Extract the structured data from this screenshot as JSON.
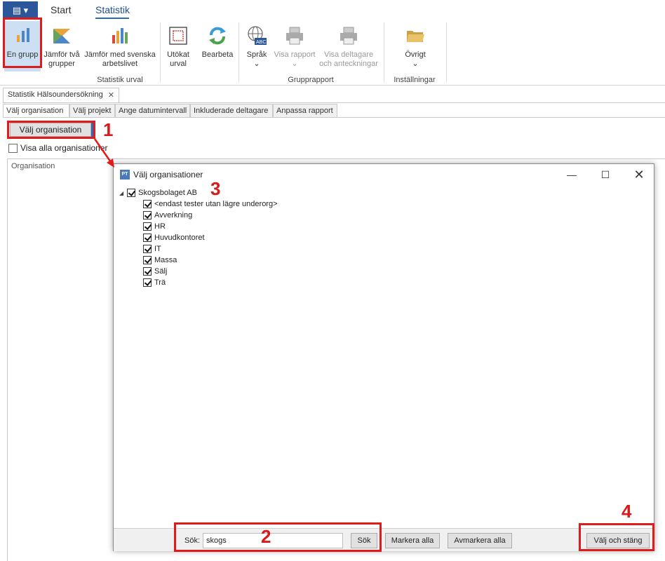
{
  "ribbon": {
    "tabs": [
      "Start",
      "Statistik"
    ],
    "active_tab": "Statistik",
    "buttons": {
      "en_grupp": "En grupp",
      "jamfor_tva": [
        "Jämför två",
        "grupper"
      ],
      "jamfor_svenska": [
        "Jämför med svenska",
        "arbetslivet"
      ],
      "utokat": [
        "Utökat",
        "urval"
      ],
      "bearbeta": "Bearbeta",
      "sprak": "Språk",
      "visa_rapport": "Visa rapport",
      "visa_deltagare": [
        "Visa deltagare",
        "och anteckningar"
      ],
      "ovrigt": "Övrigt"
    },
    "groups": {
      "statistik_urval": "Statistik urval",
      "grupprapport": "Grupprapport",
      "installningar": "Inställningar"
    }
  },
  "document": {
    "tab_title": "Statistik Hälsoundersökning",
    "subtabs": [
      "Välj organisation",
      "Välj projekt",
      "Ange datumintervall",
      "Inkluderade deltagare",
      "Anpassa rapport"
    ],
    "valj_org_button": "Välj organisation",
    "visa_alla_label": "Visa alla organisationer",
    "org_column_header": "Organisation"
  },
  "dialog": {
    "icon_text": "PT",
    "title": "Välj organisationer",
    "tree": {
      "root": "Skogsbolaget AB",
      "children": [
        "<endast tester utan lägre underorg>",
        "Avverkning",
        "HR",
        "Huvudkontoret",
        "IT",
        "Massa",
        "Sälj",
        "Trä"
      ]
    },
    "search_label": "Sök:",
    "search_value": "skogs",
    "search_button": "Sök",
    "markera_alla": "Markera alla",
    "avmarkera_alla": "Avmarkera alla",
    "valj_och_stang": "Välj och stäng"
  },
  "annotations": [
    "1",
    "2",
    "3",
    "4"
  ],
  "colors": {
    "accent": "#2b579a",
    "highlight_red": "#e01b1b",
    "selected_button_bg": "#cde0f3"
  }
}
